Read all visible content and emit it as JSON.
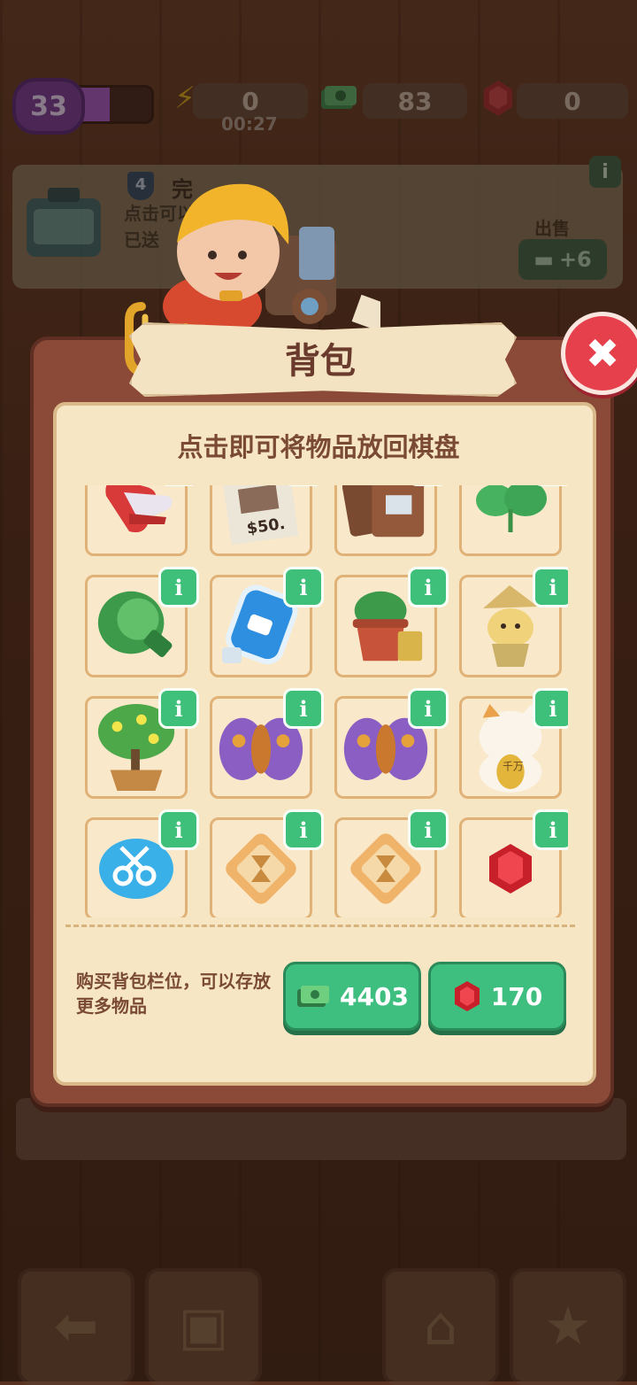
{
  "hud": {
    "level": "33",
    "level_progress": 0.48,
    "energy": "0",
    "energy_timer": "00:27",
    "cash": "83",
    "gems": "0"
  },
  "order": {
    "badge": "4",
    "title": "完",
    "line1": "点击可以",
    "line2": "已送",
    "sell_label": "出售",
    "sell_value": "+6"
  },
  "modal": {
    "title": "背包",
    "subtitle": "点击即可将物品放回棋盘",
    "close_symbol": "✖",
    "info_symbol": "i",
    "buy_text": "购买背包栏位，可以存放更多物品",
    "price_cash": "4403",
    "price_gems": "170"
  },
  "items": [
    {
      "name": "gloves-icon"
    },
    {
      "name": "wanted-poster-icon",
      "label": "$50."
    },
    {
      "name": "wallet-icon"
    },
    {
      "name": "clover-sprout-icon"
    },
    {
      "name": "lettuce-icon"
    },
    {
      "name": "water-bottle-icon"
    },
    {
      "name": "potted-plant-icon"
    },
    {
      "name": "mandrake-icon"
    },
    {
      "name": "bonsai-tree-icon"
    },
    {
      "name": "moth-icon"
    },
    {
      "name": "moth-icon"
    },
    {
      "name": "lucky-cat-icon",
      "label": "千万"
    },
    {
      "name": "scissors-cloud-icon"
    },
    {
      "name": "hourglass-tile-icon"
    },
    {
      "name": "hourglass-tile-icon"
    },
    {
      "name": "ruby-icon"
    }
  ],
  "colors": {
    "accent_green": "#3fbf7f",
    "close_red": "#e5404b",
    "panel_brown": "#8a4a37",
    "panel_cream": "#f7e6c4"
  }
}
